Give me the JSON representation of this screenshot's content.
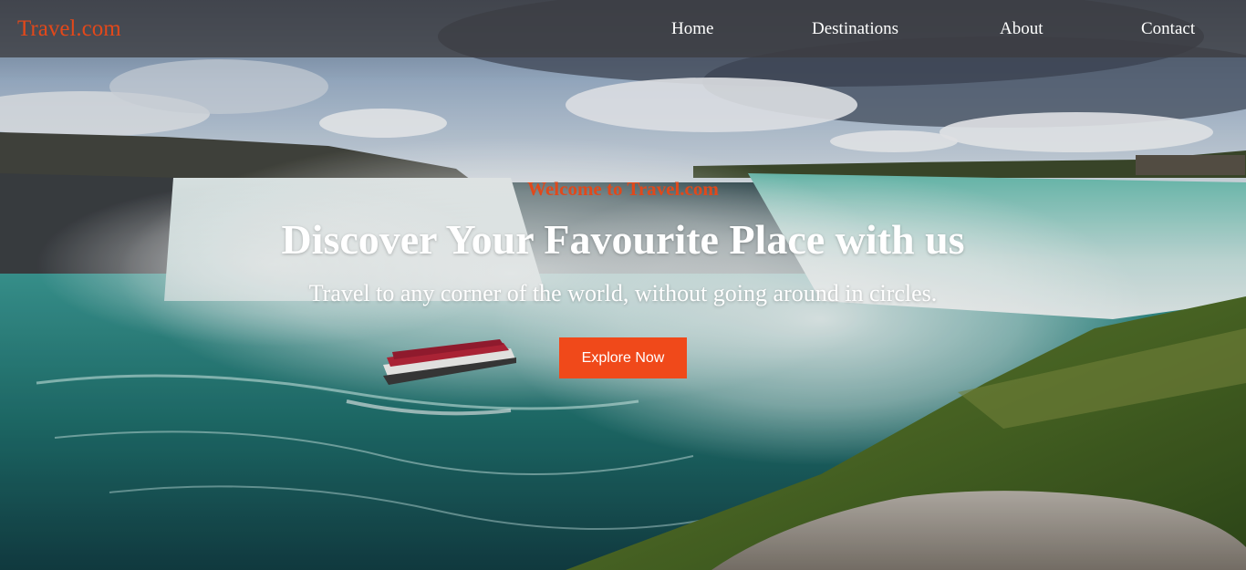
{
  "header": {
    "logo": "Travel.com",
    "nav": [
      "Home",
      "Destinations",
      "About",
      "Contact"
    ]
  },
  "hero": {
    "welcome": "Welcome to Travel.com",
    "headline": "Discover Your Favourite Place with us",
    "subline": "Travel to any corner of the world, without going around in circles.",
    "cta_label": "Explore Now"
  },
  "colors": {
    "accent": "#f0491a",
    "navbar": "#3c3c40",
    "text_light": "#ffffff"
  }
}
